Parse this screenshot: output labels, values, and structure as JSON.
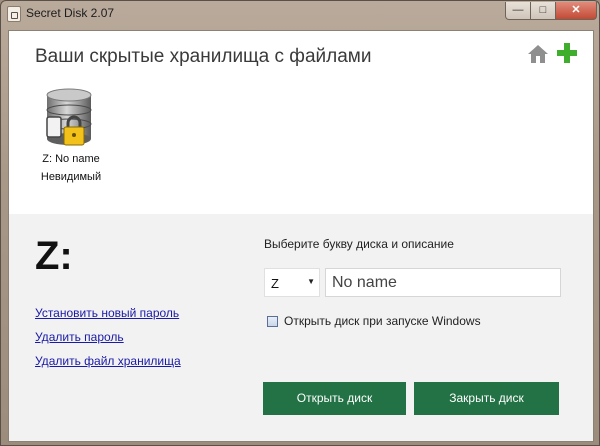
{
  "window": {
    "title": "Secret Disk 2.07",
    "controls": {
      "minimize": "—",
      "maximize": "□",
      "close": "✕"
    }
  },
  "header": {
    "title": "Ваши скрытые хранилища с файлами",
    "home_icon": "home-icon",
    "add_icon": "plus-icon",
    "accent_color": "#3fae2c"
  },
  "disks": [
    {
      "label": "Z: No name",
      "status": "Невидимый",
      "icon": "locked-database-icon"
    }
  ],
  "details": {
    "drive_letter": "Z:",
    "links": {
      "set_password": "Установить новый пароль",
      "delete_password": "Удалить пароль",
      "delete_storage": "Удалить файл хранилища"
    },
    "choose_label": "Выберите букву диска и описание",
    "drive_select_value": "Z",
    "name_value": "No name",
    "autostart_label": "Открыть диск при запуске Windows",
    "autostart_checked": false
  },
  "buttons": {
    "open": "Открыть диск",
    "close": "Закрыть диск",
    "color": "#237245"
  }
}
